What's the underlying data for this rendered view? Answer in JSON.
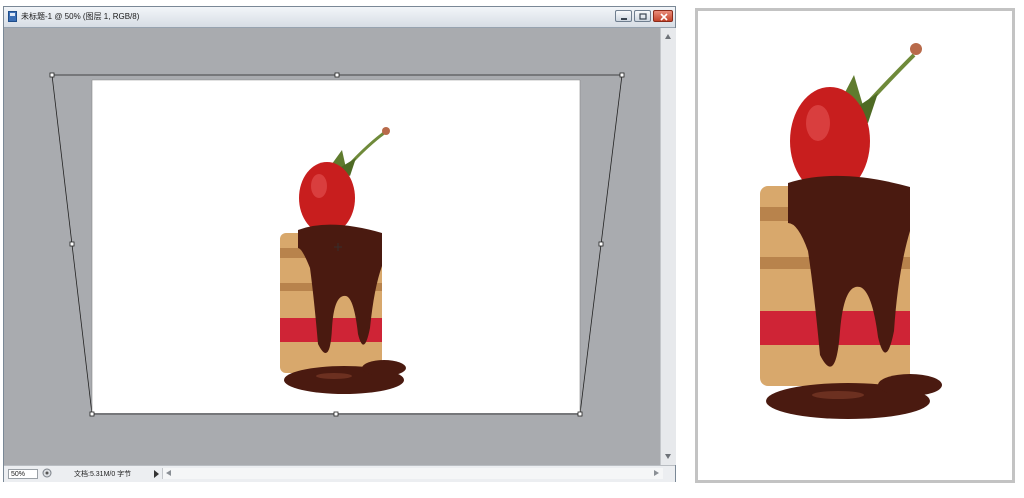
{
  "window": {
    "title": "未标题-1 @ 50% (图层 1, RGB/8)",
    "minimize_icon": "minimize-icon",
    "restore_icon": "restore-icon",
    "close_icon": "close-icon"
  },
  "status": {
    "zoom": "50%",
    "doc_info": "文档:5.31M/0 字节"
  },
  "canvas": {
    "image_subject": "strawberry-chocolate-cake"
  },
  "colors": {
    "workspace": "#a9abaf",
    "chocolate": "#4a1a10",
    "strawberry": "#c81e1e",
    "close_button": "#c3432b"
  }
}
